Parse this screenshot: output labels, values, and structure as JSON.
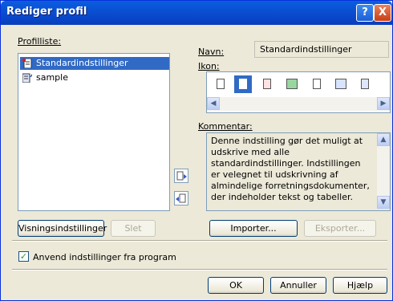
{
  "window": {
    "title": "Rediger profil"
  },
  "titlebar_buttons": {
    "help": "?",
    "close": "X"
  },
  "profile_list": {
    "label": "Profilliste:",
    "items": [
      {
        "label": "Standardindstillinger",
        "selected": true,
        "icon": "default-profile-icon"
      },
      {
        "label": "sample",
        "selected": false,
        "icon": "document-profile-icon"
      }
    ]
  },
  "name_field": {
    "label": "Navn:",
    "value": "Standardindstillinger"
  },
  "icon_picker": {
    "label": "Ikon:",
    "selected_index": 1
  },
  "comment": {
    "label": "Kommentar:",
    "text": "Denne indstilling gør det muligt at udskrive med alle standardindstillinger. Indstillingen er velegnet til udskrivning af almindelige forretningsdokumenter, der indeholder tekst og tabeller."
  },
  "buttons": {
    "display_settings": "Visningsindstillinger",
    "delete": "Slet",
    "import": "Importer...",
    "export": "Eksporter...",
    "ok": "OK",
    "cancel": "Annuller",
    "help": "Hjælp"
  },
  "checkbox": {
    "label": "Anvend indstillinger fra program",
    "checked": true
  },
  "colors": {
    "title_bar": "#0a4ed1",
    "selection": "#316ac5",
    "dialog_bg": "#ece9d8"
  }
}
